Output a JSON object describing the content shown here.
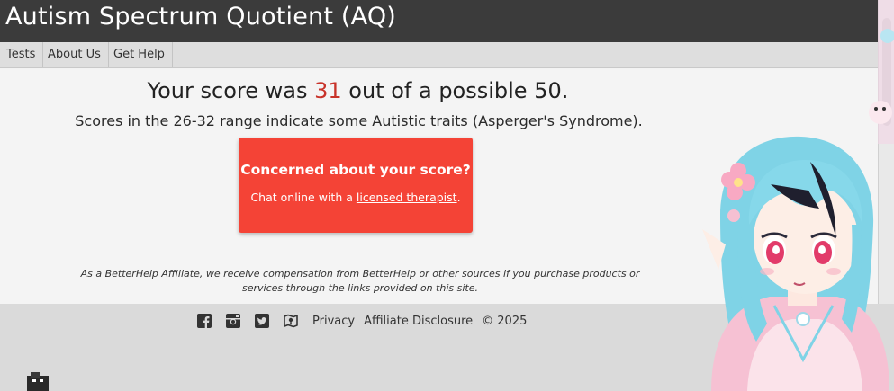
{
  "header": {
    "title": "Autism Spectrum Quotient (AQ)"
  },
  "nav": {
    "items": [
      "Tests",
      "About Us",
      "Get Help"
    ]
  },
  "result": {
    "score_prefix": "Your score was",
    "score": "31",
    "score_suffix": "out of a possible 50.",
    "range_text": "Scores in the 26-32 range indicate some Autistic traits (Asperger's Syndrome)."
  },
  "cta": {
    "title": "Concerned about your score?",
    "text_before": "Chat online with a",
    "link": "licensed therapist",
    "text_after": "."
  },
  "disclaimer": "As a BetterHelp Affiliate, we receive compensation from BetterHelp or other sources if you purchase products or services through the links provided on this site.",
  "footer": {
    "social_icons": [
      "facebook-icon",
      "instagram-icon",
      "twitter-icon",
      "map-icon"
    ],
    "links": [
      "Privacy",
      "Affiliate Disclosure"
    ],
    "copyright": "© 2025"
  },
  "colors": {
    "header_bg": "#3b3b3b",
    "nav_bg": "#dedede",
    "score_accent": "#c8332a",
    "cta_bg": "#f44336",
    "footer_bg": "#dadada"
  }
}
